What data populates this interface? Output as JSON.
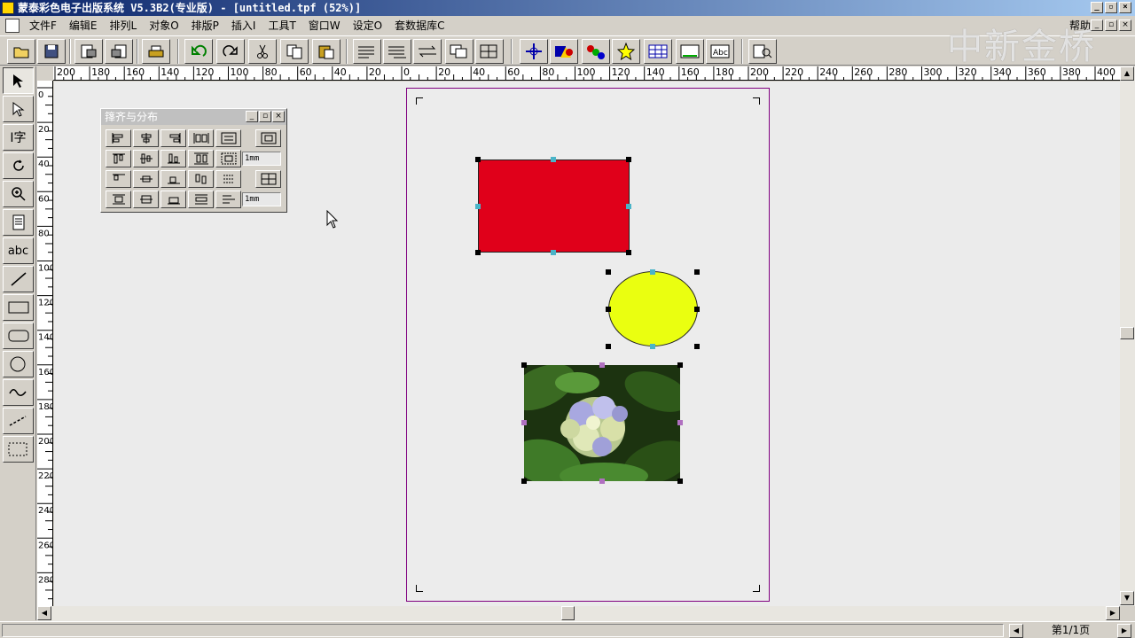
{
  "window": {
    "title": "蒙泰彩色电子出版系统 V5.3B2(专业版) - [untitled.tpf (52%)]"
  },
  "menu": {
    "items": [
      "文件F",
      "编辑E",
      "排列L",
      "对象O",
      "排版P",
      "插入I",
      "工具T",
      "窗口W",
      "设定O",
      "套数据库C"
    ],
    "help": "帮助H"
  },
  "watermark": "中新金桥",
  "ruler": {
    "h_labels": [
      "200",
      "180",
      "160",
      "140",
      "120",
      "100",
      "80",
      "60",
      "40",
      "20",
      "0",
      "20",
      "40",
      "60",
      "80",
      "100",
      "120",
      "140",
      "160",
      "180",
      "200",
      "220",
      "240",
      "260",
      "280",
      "300",
      "320",
      "340",
      "360",
      "380",
      "400"
    ],
    "v_labels": [
      "0",
      "20",
      "40",
      "60",
      "80",
      "100",
      "120",
      "140",
      "160",
      "180",
      "200",
      "220",
      "240",
      "260",
      "280"
    ]
  },
  "align_panel": {
    "title": "箨齐与分布",
    "spacing_h": "1mm",
    "spacing_v": "1mm"
  },
  "status": {
    "page": "第1/1页"
  },
  "colors": {
    "rect_fill": "#e0001a",
    "ellipse_fill": "#eaff10",
    "page_border": "#800080",
    "titlebar": "#0a246a"
  }
}
